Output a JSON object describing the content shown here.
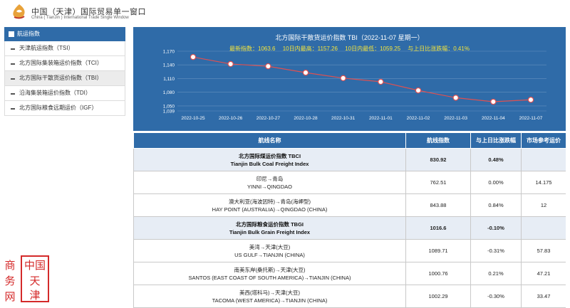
{
  "header": {
    "title_cn": "中国（天津）国际贸易单一窗口",
    "title_en": "China ( TianJin ) International Trade Single Window"
  },
  "sidebar": {
    "heading": "航运指数",
    "items": [
      {
        "label": "天津航运指数（TSI）",
        "active": false
      },
      {
        "label": "北方国际集装箱运价指数（TCI）",
        "active": false
      },
      {
        "label": "北方国际干散货运价指数（TBI）",
        "active": true
      },
      {
        "label": "沿海集装箱运价指数（TDI）",
        "active": false
      },
      {
        "label": "北方国际粮食远期运价（IGF）",
        "active": false
      }
    ]
  },
  "chart_panel": {
    "title": "北方国际干散货运价指数 TBI（2022-11-07 星期一）",
    "stats": {
      "latest": "最新指数：1063.6",
      "high": "10日内最高：1157.26",
      "low": "10日内最低：1059.25",
      "change": "与上日比涨跌幅：0.41%"
    }
  },
  "chart_data": {
    "type": "line",
    "x": [
      "2022-10-25",
      "2022-10-26",
      "2022-10-27",
      "2022-10-28",
      "2022-10-31",
      "2022-11-01",
      "2022-11-02",
      "2022-11-03",
      "2022-11-04",
      "2022-11-07"
    ],
    "values": [
      1157.26,
      1142,
      1137,
      1123,
      1111,
      1103,
      1084,
      1068,
      1059.25,
      1063.6
    ],
    "y_ticks": [
      "1,170",
      "1,140",
      "1,110",
      "1,080",
      "1,050",
      "1,039"
    ],
    "ylim": [
      1039,
      1170
    ],
    "grid": true,
    "colors": {
      "line": "#e05050",
      "point": "#ffffff",
      "text": "#ffffff"
    }
  },
  "table": {
    "headers": [
      "航线名称",
      "航线指数",
      "与上日比涨跌幅",
      "市场参考运价"
    ],
    "rows": [
      {
        "group": true,
        "name_cn": "北方国际煤运价指数 TBCI",
        "name_en": "Tianjin Bulk Coal Freight Index",
        "index": "830.92",
        "change": "0.48%",
        "price": ""
      },
      {
        "group": false,
        "name_cn": "印尼→青岛",
        "name_en": "YINNI→QINGDAO",
        "index": "762.51",
        "change": "0.00%",
        "price": "14.175"
      },
      {
        "group": false,
        "name_cn": "澳大利亚(海波因特)→青岛(海岬型)",
        "name_en": "HAY POINT (AUSTRALIA)→QINGDAO (CHINA)",
        "index": "843.88",
        "change": "0.84%",
        "price": "12"
      },
      {
        "group": true,
        "name_cn": "北方国际粮食运价指数 TBGI",
        "name_en": "Tianjin Bulk Grain Freight Index",
        "index": "1016.6",
        "change": "-0.10%",
        "price": ""
      },
      {
        "group": false,
        "name_cn": "美湾→天津(大豆)",
        "name_en": "US GULF→TIANJIN (CHINA)",
        "index": "1089.71",
        "change": "-0.31%",
        "price": "57.83"
      },
      {
        "group": false,
        "name_cn": "南美东岸(桑托斯)→天津(大豆)",
        "name_en": "SANTOS (EAST COAST OF SOUTH AMERICA)→TIANJIN (CHINA)",
        "index": "1000.76",
        "change": "0.21%",
        "price": "47.21"
      },
      {
        "group": false,
        "name_cn": "美西(塔科马)→天津(大豆)",
        "name_en": "TACOMA (WEST AMERICA)→TIANJIN (CHINA)",
        "index": "1002.29",
        "change": "-0.30%",
        "price": "33.47"
      }
    ]
  },
  "seal": {
    "chars": [
      "商",
      "中",
      "国",
      "务",
      "天",
      "网",
      "津"
    ],
    "color": "#d42a2a"
  }
}
